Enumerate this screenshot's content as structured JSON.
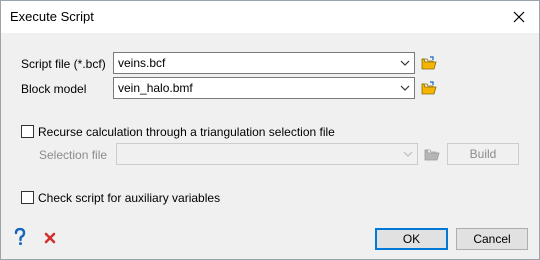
{
  "window": {
    "title": "Execute Script"
  },
  "form": {
    "script_file": {
      "label": "Script file (*.bcf)",
      "value": "veins.bcf"
    },
    "block_model": {
      "label": "Block model",
      "value": "vein_halo.bmf"
    },
    "recurse": {
      "label": "Recurse calculation through a triangulation selection file",
      "checked": false
    },
    "selection_file": {
      "label": "Selection file",
      "value": ""
    },
    "build_label": "Build",
    "check_script": {
      "label": "Check script for auxiliary variables",
      "checked": false
    }
  },
  "footer": {
    "ok_label": "OK",
    "cancel_label": "Cancel"
  },
  "icons": {
    "help": "question-mark-icon",
    "cancel": "red-x-icon",
    "folder": "open-folder-icon",
    "close": "close-icon"
  },
  "colors": {
    "accent": "#0078d7",
    "help_blue": "#1565c0",
    "cancel_red": "#d32f2f",
    "folder_yellow": "#f4b400"
  }
}
